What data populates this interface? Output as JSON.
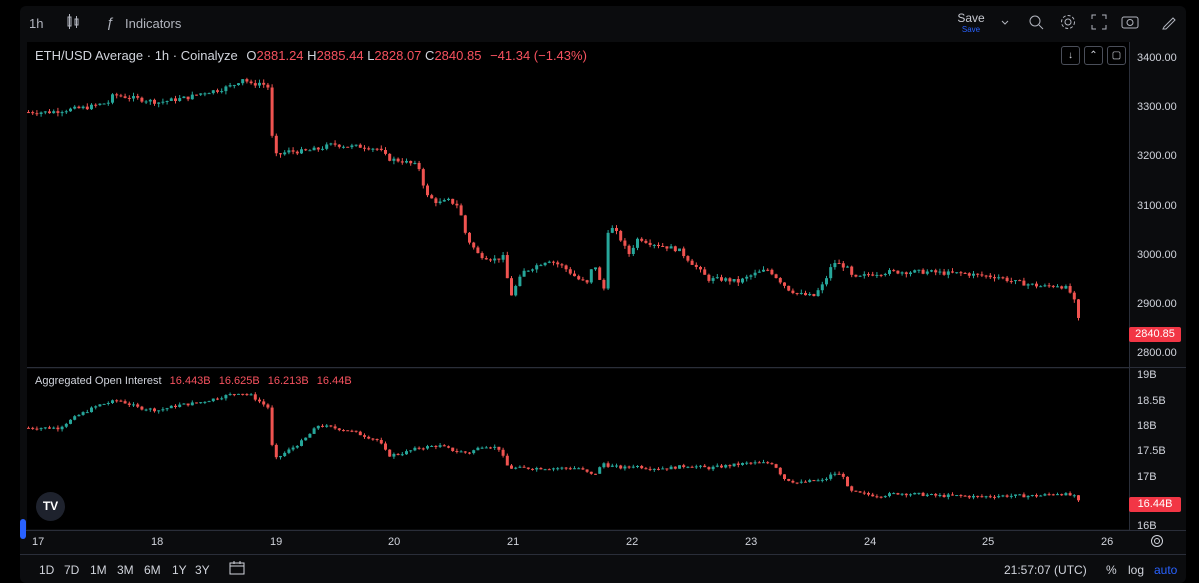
{
  "toolbar": {
    "timeframe": "1h",
    "indicators_label": "Indicators",
    "save_label": "Save",
    "save_sub": "Save"
  },
  "legend": {
    "symbol": "ETH/USD Average · 1h · Coinalyze",
    "o_key": "O",
    "o_val": "2881.24",
    "h_key": "H",
    "h_val": "2885.44",
    "l_key": "L",
    "l_val": "2828.07",
    "c_key": "C",
    "c_val": "2840.85",
    "change": "−41.34 (−1.43%)"
  },
  "oi_legend": {
    "title": "Aggregated Open Interest",
    "v1": "16.443B",
    "v2": "16.625B",
    "v3": "16.213B",
    "v4": "16.44B"
  },
  "price_axis": [
    "3400.00",
    "3300.00",
    "3200.00",
    "3100.00",
    "3000.00",
    "2900.00",
    "2800.00"
  ],
  "price_tag": "2840.85",
  "oi_axis": [
    "19B",
    "18.5B",
    "18B",
    "17.5B",
    "17B",
    "16B"
  ],
  "oi_tag": "16.44B",
  "x_axis": [
    "17",
    "18",
    "19",
    "20",
    "21",
    "22",
    "23",
    "24",
    "25",
    "26"
  ],
  "bottom": {
    "ranges": [
      "1D",
      "7D",
      "1M",
      "3M",
      "6M",
      "1Y",
      "3Y"
    ],
    "clock": "21:57:07 (UTC)",
    "percent": "%",
    "log": "log",
    "auto": "auto"
  },
  "logo_text": "TV",
  "colors": {
    "up": "#26a69a",
    "down": "#ef5350",
    "accent": "#2962ff"
  },
  "chart_data": {
    "type": "candlestick",
    "price_close_points": [
      [
        0,
        3290
      ],
      [
        20,
        3290
      ],
      [
        40,
        3295
      ],
      [
        60,
        3300
      ],
      [
        80,
        3310
      ],
      [
        85,
        3325
      ],
      [
        100,
        3320
      ],
      [
        115,
        3315
      ],
      [
        130,
        3310
      ],
      [
        145,
        3315
      ],
      [
        160,
        3320
      ],
      [
        175,
        3330
      ],
      [
        190,
        3335
      ],
      [
        205,
        3345
      ],
      [
        215,
        3360
      ],
      [
        222,
        3345
      ],
      [
        232,
        3350
      ],
      [
        240,
        3340
      ],
      [
        245,
        3200
      ],
      [
        260,
        3210
      ],
      [
        275,
        3210
      ],
      [
        290,
        3215
      ],
      [
        305,
        3225
      ],
      [
        320,
        3220
      ],
      [
        335,
        3220
      ],
      [
        350,
        3215
      ],
      [
        360,
        3195
      ],
      [
        375,
        3190
      ],
      [
        390,
        3180
      ],
      [
        398,
        3120
      ],
      [
        410,
        3105
      ],
      [
        420,
        3110
      ],
      [
        430,
        3100
      ],
      [
        438,
        3035
      ],
      [
        450,
        3000
      ],
      [
        465,
        2990
      ],
      [
        475,
        2995
      ],
      [
        482,
        2915
      ],
      [
        495,
        2965
      ],
      [
        510,
        2980
      ],
      [
        520,
        2990
      ],
      [
        535,
        2975
      ],
      [
        550,
        2950
      ],
      [
        560,
        2940
      ],
      [
        565,
        2990
      ],
      [
        575,
        2920
      ],
      [
        580,
        3060
      ],
      [
        590,
        3040
      ],
      [
        600,
        3000
      ],
      [
        610,
        3035
      ],
      [
        620,
        3025
      ],
      [
        630,
        3020
      ],
      [
        650,
        3010
      ],
      [
        660,
        2990
      ],
      [
        670,
        2970
      ],
      [
        680,
        2950
      ],
      [
        695,
        2950
      ],
      [
        710,
        2945
      ],
      [
        725,
        2960
      ],
      [
        740,
        2970
      ],
      [
        750,
        2950
      ],
      [
        760,
        2930
      ],
      [
        770,
        2920
      ],
      [
        785,
        2915
      ],
      [
        795,
        2940
      ],
      [
        805,
        2985
      ],
      [
        818,
        2975
      ],
      [
        825,
        2950
      ],
      [
        840,
        2960
      ],
      [
        860,
        2965
      ],
      [
        880,
        2965
      ],
      [
        900,
        2965
      ],
      [
        920,
        2962
      ],
      [
        935,
        2962
      ],
      [
        950,
        2958
      ],
      [
        970,
        2955
      ],
      [
        985,
        2945
      ],
      [
        1000,
        2940
      ],
      [
        1015,
        2935
      ],
      [
        1030,
        2938
      ],
      [
        1040,
        2930
      ],
      [
        1048,
        2895
      ],
      [
        1052,
        2840
      ]
    ],
    "oi_close_points": [
      [
        0,
        17.95
      ],
      [
        30,
        17.95
      ],
      [
        50,
        18.2
      ],
      [
        70,
        18.4
      ],
      [
        90,
        18.5
      ],
      [
        110,
        18.35
      ],
      [
        130,
        18.3
      ],
      [
        150,
        18.4
      ],
      [
        170,
        18.45
      ],
      [
        190,
        18.55
      ],
      [
        210,
        18.65
      ],
      [
        222,
        18.6
      ],
      [
        240,
        18.35
      ],
      [
        245,
        17.3
      ],
      [
        260,
        17.5
      ],
      [
        275,
        17.7
      ],
      [
        290,
        18.0
      ],
      [
        305,
        17.95
      ],
      [
        320,
        17.9
      ],
      [
        335,
        17.8
      ],
      [
        350,
        17.7
      ],
      [
        360,
        17.4
      ],
      [
        375,
        17.45
      ],
      [
        390,
        17.55
      ],
      [
        410,
        17.6
      ],
      [
        425,
        17.5
      ],
      [
        440,
        17.45
      ],
      [
        455,
        17.6
      ],
      [
        470,
        17.55
      ],
      [
        480,
        17.15
      ],
      [
        495,
        17.15
      ],
      [
        510,
        17.15
      ],
      [
        530,
        17.15
      ],
      [
        550,
        17.15
      ],
      [
        565,
        17.0
      ],
      [
        575,
        17.25
      ],
      [
        580,
        17.2
      ],
      [
        595,
        17.15
      ],
      [
        605,
        17.2
      ],
      [
        620,
        17.15
      ],
      [
        640,
        17.15
      ],
      [
        660,
        17.2
      ],
      [
        680,
        17.15
      ],
      [
        700,
        17.2
      ],
      [
        720,
        17.25
      ],
      [
        745,
        17.25
      ],
      [
        755,
        16.95
      ],
      [
        770,
        16.85
      ],
      [
        785,
        16.9
      ],
      [
        795,
        16.9
      ],
      [
        805,
        17.05
      ],
      [
        815,
        17.0
      ],
      [
        820,
        16.7
      ],
      [
        830,
        16.65
      ],
      [
        850,
        16.6
      ],
      [
        870,
        16.65
      ],
      [
        890,
        16.63
      ],
      [
        910,
        16.6
      ],
      [
        930,
        16.6
      ],
      [
        950,
        16.58
      ],
      [
        970,
        16.6
      ],
      [
        990,
        16.6
      ],
      [
        1010,
        16.6
      ],
      [
        1030,
        16.65
      ],
      [
        1045,
        16.6
      ],
      [
        1052,
        16.44
      ]
    ],
    "price_ylim": [
      2800,
      3400
    ],
    "oi_ylim": [
      16,
      19
    ]
  }
}
